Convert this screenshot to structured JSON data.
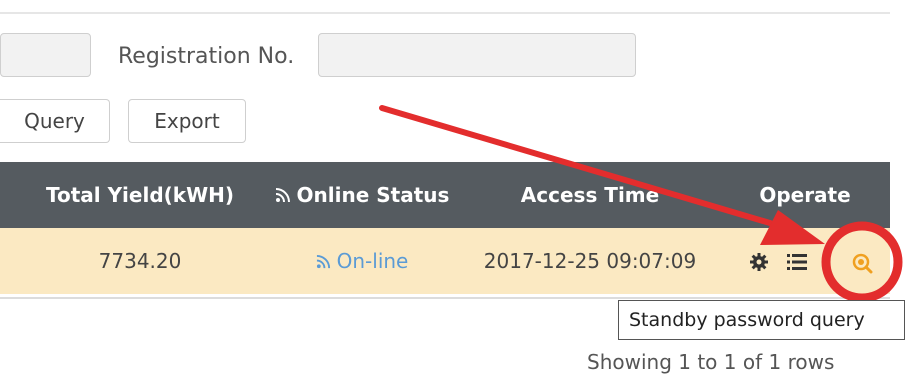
{
  "filters": {
    "registration_label": "Registration No.",
    "registration_value": "",
    "left_field_value": ""
  },
  "toolbar": {
    "query_label": "Query",
    "export_label": "Export"
  },
  "table": {
    "columns": {
      "total_yield": "Total Yield(kWH)",
      "online_status": "Online Status",
      "access_time": "Access Time",
      "operate": "Operate"
    },
    "rows": [
      {
        "total_yield": "7734.20",
        "online_status": "On-line",
        "access_time": "2017-12-25 09:07:09"
      }
    ]
  },
  "tooltip": {
    "text": "Standby password query"
  },
  "pagination": {
    "summary": "Showing 1 to 1 of 1 rows"
  },
  "colors": {
    "header_bg": "#555b60",
    "row_bg": "#fbe9c2",
    "online_text": "#5b9bd5",
    "annotation_red": "#e32d2d",
    "search_icon": "#f0a020"
  },
  "icons": {
    "wifi": "wifi-icon",
    "settings": "gear-icon",
    "list": "list-icon",
    "search": "magnifier-icon"
  }
}
